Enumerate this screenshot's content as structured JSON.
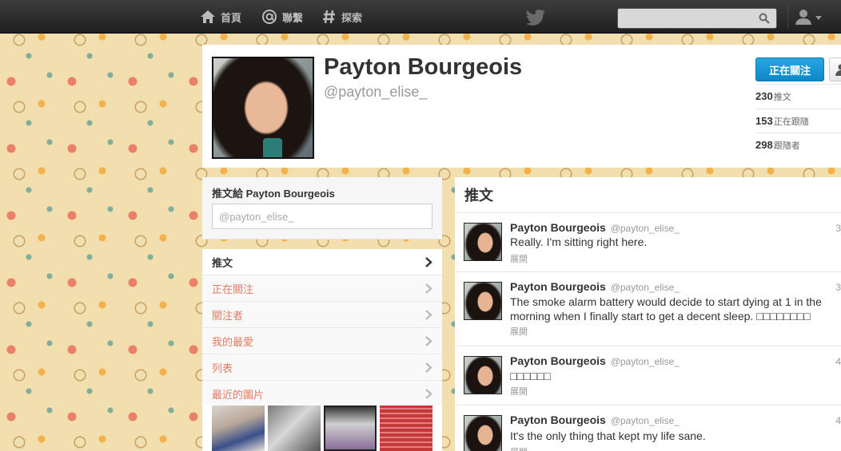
{
  "topbar": {
    "nav": [
      {
        "label": "首頁",
        "icon": "home-icon"
      },
      {
        "label": "聯繫",
        "icon": "at-icon"
      },
      {
        "label": "探索",
        "icon": "hashtag-icon"
      }
    ],
    "search": {
      "placeholder": "",
      "value": ""
    },
    "logo": "twitter-bird-icon"
  },
  "profile": {
    "full_name": "Payton Bourgeois",
    "screen_name": "@payton_elise_",
    "follow_button": "正在關注",
    "stats": [
      {
        "value": "230",
        "label": "推文"
      },
      {
        "value": "153",
        "label": "正在跟隨"
      },
      {
        "value": "298",
        "label": "跟隨者"
      }
    ]
  },
  "compose": {
    "title": "推文給 Payton Bourgeois",
    "placeholder": "@payton_elise_"
  },
  "side_nav": {
    "items": [
      {
        "label": "推文"
      },
      {
        "label": "正在關注"
      },
      {
        "label": "關注者"
      },
      {
        "label": "我的最愛"
      },
      {
        "label": "列表"
      },
      {
        "label": "最近的圖片"
      }
    ]
  },
  "timeline": {
    "header": "推文",
    "tweets": [
      {
        "name": "Payton Bourgeois",
        "handle": "@payton_elise_",
        "time": "3",
        "text": "Really. I'm sitting right here.",
        "expand": "展開"
      },
      {
        "name": "Payton Bourgeois",
        "handle": "@payton_elise_",
        "time": "3",
        "text": "The smoke alarm battery would decide to start dying at 1 in the morning when I finally start to get a decent sleep. □□□□□□□□",
        "expand": "展開"
      },
      {
        "name": "Payton Bourgeois",
        "handle": "@payton_elise_",
        "time": "4",
        "text": "□□□□□□",
        "expand": "展開"
      },
      {
        "name": "Payton Bourgeois",
        "handle": "@payton_elise_",
        "time": "4",
        "text": "It's the only thing that kept my life sane.",
        "expand": "展開"
      }
    ]
  },
  "colors": {
    "accent_blue": "#1b95d6",
    "link_orange": "#e07b63",
    "topbar": "#2a2a2a",
    "background": "#f2dfb0"
  }
}
